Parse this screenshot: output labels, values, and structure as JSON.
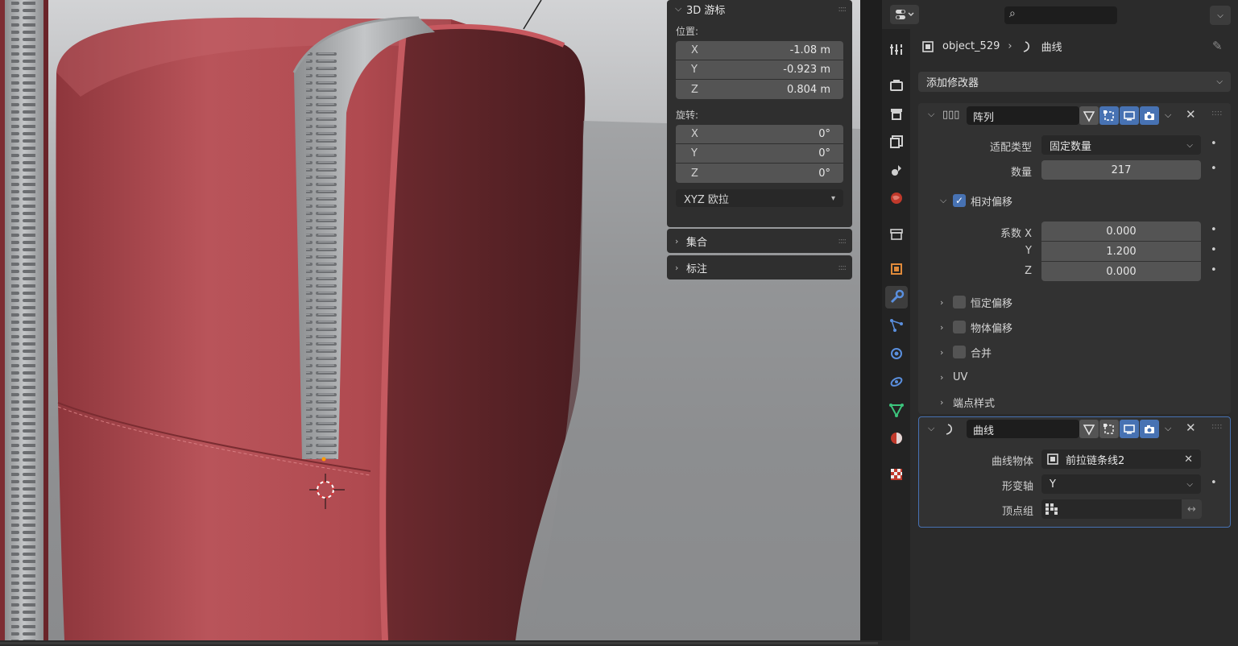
{
  "cursor_panel": {
    "title": "3D 游标",
    "location_label": "位置:",
    "location": [
      {
        "axis": "X",
        "value": "-1.08 m"
      },
      {
        "axis": "Y",
        "value": "-0.923 m"
      },
      {
        "axis": "Z",
        "value": "0.804 m"
      }
    ],
    "rotation_label": "旋转:",
    "rotation": [
      {
        "axis": "X",
        "value": "0°"
      },
      {
        "axis": "Y",
        "value": "0°"
      },
      {
        "axis": "Z",
        "value": "0°"
      }
    ],
    "rotation_mode": "XYZ 欧拉"
  },
  "collections_panel": {
    "title": "集合"
  },
  "annotation_panel": {
    "title": "标注"
  },
  "properties": {
    "breadcrumb_object": "object_529",
    "breadcrumb_modifier": "曲线",
    "add_modifier_label": "添加修改器",
    "active_tab": "modifier-tab",
    "tabs": [
      "tool-icon",
      "render-icon",
      "output-icon",
      "view-layer-icon",
      "scene-icon",
      "world-icon",
      "collection-icon",
      "object-icon",
      "modifier-icon",
      "particles-icon",
      "physics-icon",
      "constraints-icon",
      "data-icon",
      "material-icon",
      "texture-icon"
    ]
  },
  "array_modifier": {
    "name": "阵列",
    "fit_type_label": "适配类型",
    "fit_type_value": "固定数量",
    "count_label": "数量",
    "count_value": "217",
    "relative_offset_label": "相对偏移",
    "relative_offset_checked": true,
    "factor_x_label": "系数 X",
    "factor_x_value": "0.000",
    "factor_y_label": "Y",
    "factor_y_value": "1.200",
    "factor_z_label": "Z",
    "factor_z_value": "0.000",
    "constant_offset_label": "恒定偏移",
    "object_offset_label": "物体偏移",
    "merge_label": "合并",
    "uv_label": "UV",
    "caps_label": "端点样式"
  },
  "curve_modifier": {
    "name": "曲线",
    "curve_object_label": "曲线物体",
    "curve_object_value": "前拉链条线2",
    "deform_axis_label": "形变轴",
    "deform_axis_value": "Y",
    "vertex_group_label": "顶点组",
    "vertex_group_value": ""
  },
  "colors": {
    "accent": "#4772b3",
    "panel": "#2b2b2b",
    "field": "#545454",
    "fabric": "#b0484e"
  }
}
